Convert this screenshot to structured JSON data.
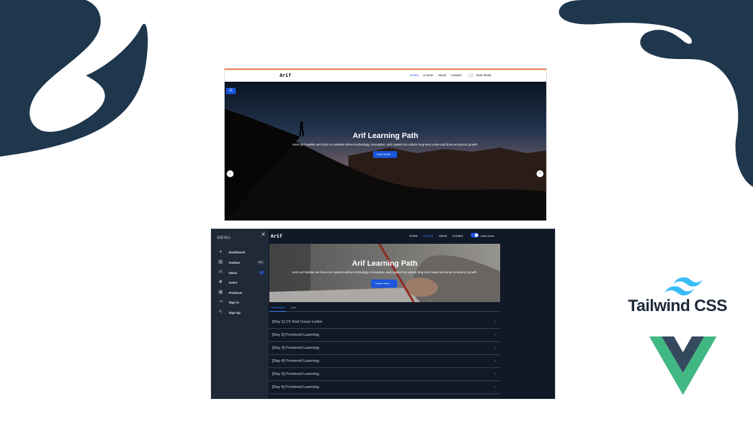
{
  "top_screenshot": {
    "brand": "Arif",
    "nav_links": [
      {
        "label": "Home",
        "active": true
      },
      {
        "label": "Course",
        "active": false
      },
      {
        "label": "About",
        "active": false
      },
      {
        "label": "Contact",
        "active": false
      }
    ],
    "dark_mode_label": "Dark Mode",
    "menu_icon": "hamburger-icon",
    "hero": {
      "title": "Arif Learning Path",
      "subtitle": "Here at Flowbite we focus on markets where technology, innovation, and capital can unlock long-term value and drive economic growth.",
      "cta": "Learn more →"
    },
    "prev_icon": "chevron-left-icon",
    "next_icon": "chevron-right-icon"
  },
  "bottom_screenshot": {
    "sidebar": {
      "title": "MENU",
      "close_icon": "close-icon",
      "items": [
        {
          "label": "Dashboard",
          "icon": "pie-chart-icon",
          "badge": ""
        },
        {
          "label": "Kanban",
          "icon": "grid-icon",
          "badge": "Pro"
        },
        {
          "label": "Inbox",
          "icon": "inbox-icon",
          "badge": "3"
        },
        {
          "label": "Users",
          "icon": "users-icon",
          "badge": ""
        },
        {
          "label": "Products",
          "icon": "shopping-bag-icon",
          "badge": ""
        },
        {
          "label": "Sign In",
          "icon": "sign-in-icon",
          "badge": ""
        },
        {
          "label": "Sign Up",
          "icon": "sign-up-icon",
          "badge": ""
        }
      ]
    },
    "brand": "Arif",
    "nav_links": [
      {
        "label": "Home",
        "active": false
      },
      {
        "label": "Course",
        "active": true
      },
      {
        "label": "About",
        "active": false
      },
      {
        "label": "Contact",
        "active": false
      }
    ],
    "dark_mode_label": "Dark Mode",
    "hero": {
      "title": "Arif Learning Path",
      "subtitle": "Here at Flowbite we focus on markets where technology, innovation, and capital can unlock long-term value and drive economic growth.",
      "cta": "Learn more →"
    },
    "tabs": [
      {
        "label": "Dashboard",
        "active": true
      },
      {
        "label": "User",
        "active": false
      }
    ],
    "accordion": [
      "[Day 1] CV And Cover Letter",
      "[Day 2] Frontend Learning",
      "[Day 3] Frontend Learning",
      "[Day 4] Frontend Learning",
      "[Day 5] Frontend Learning",
      "[Day 6] Frontend Learning"
    ]
  },
  "logos": {
    "tailwind_text": "Tailwind CSS",
    "tailwind_icon": "tailwind-wave-icon",
    "vue_icon": "vue-logo-icon"
  },
  "colors": {
    "blob": "#1e374d",
    "primary": "#1a56db",
    "dark_bg": "#111827",
    "sidebar_bg": "#1f2937",
    "tailwind": "#38bdf8",
    "vue_green": "#41b883",
    "vue_dark": "#35495e"
  }
}
